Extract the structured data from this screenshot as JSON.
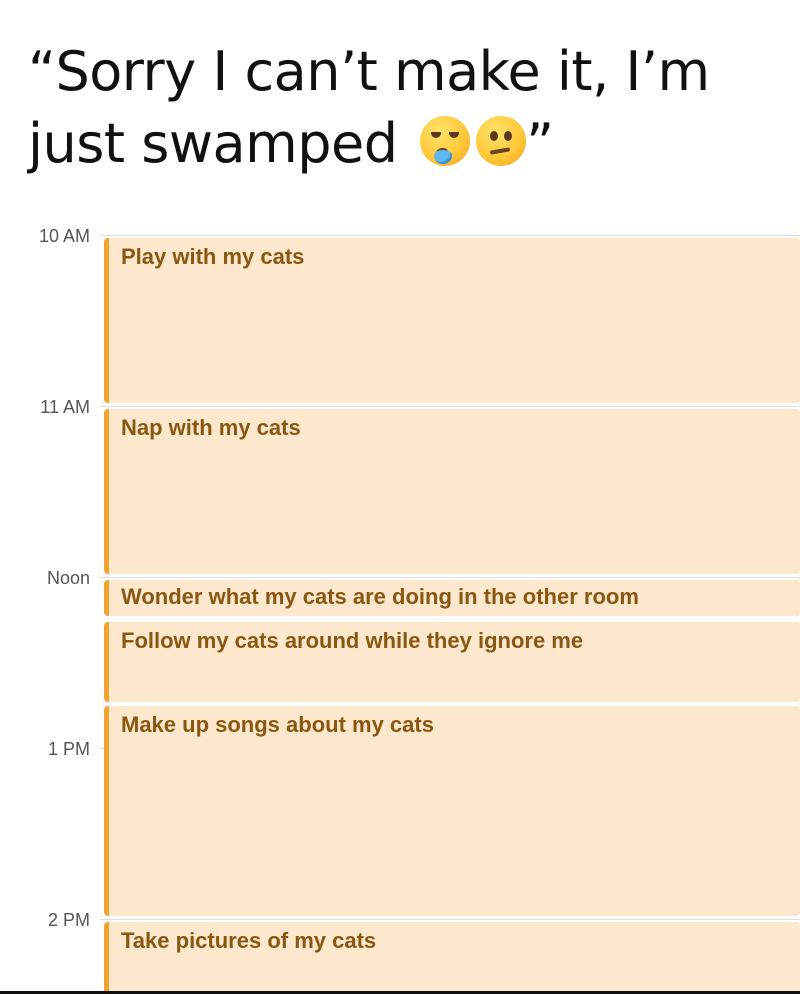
{
  "caption": {
    "line1": "“Sorry I can’t make it, I’m",
    "line2": "just swamped",
    "close_quote": "”",
    "emojis": [
      "sleepy-face-emoji",
      "confused-face-emoji"
    ]
  },
  "calendar": {
    "hours": [
      "10 AM",
      "11 AM",
      "Noon",
      "1 PM",
      "2 PM"
    ],
    "events": [
      {
        "title": "Play with my cats"
      },
      {
        "title": "Nap with my cats"
      },
      {
        "title": "Wonder what my cats are doing in the other room"
      },
      {
        "title": "Follow my cats around while they ignore me"
      },
      {
        "title": "Make up songs about my cats"
      },
      {
        "title": "Take pictures of my cats"
      }
    ],
    "colors": {
      "event_background": "#fde8cd",
      "event_accent": "#f2a430",
      "event_text": "#8a5710"
    }
  }
}
